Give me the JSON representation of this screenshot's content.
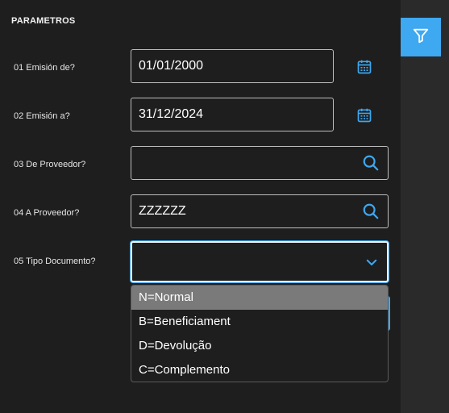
{
  "parameters": {
    "title": "PARAMETROS",
    "fields": [
      {
        "label": "01 Emisión de?",
        "value": "01/01/2000",
        "icon": "calendar-icon"
      },
      {
        "label": "02 Emisión a?",
        "value": "31/12/2024",
        "icon": "calendar-icon"
      },
      {
        "label": "03 De Proveedor?",
        "value": "",
        "icon": "search-icon"
      },
      {
        "label": "04 A Proveedor?",
        "value": "ZZZZZZ",
        "icon": "search-icon"
      },
      {
        "label": "05 Tipo Documento?",
        "value": "",
        "icon": "chevron-down-icon"
      }
    ]
  },
  "tipo_documento_options": [
    {
      "label": "N=Normal",
      "highlighted": true
    },
    {
      "label": "B=Beneficiament",
      "highlighted": false
    },
    {
      "label": "D=Devolução",
      "highlighted": false
    },
    {
      "label": "C=Complemento",
      "highlighted": false
    }
  ],
  "toolbar": {
    "filter_icon": "filter-icon"
  },
  "colors": {
    "accent": "#3ea8f0",
    "panel_bg": "#1e1e1e",
    "page_bg": "#2a2a2a",
    "option_highlight": "#7a7a7a",
    "field_border": "#bdbdbd"
  }
}
